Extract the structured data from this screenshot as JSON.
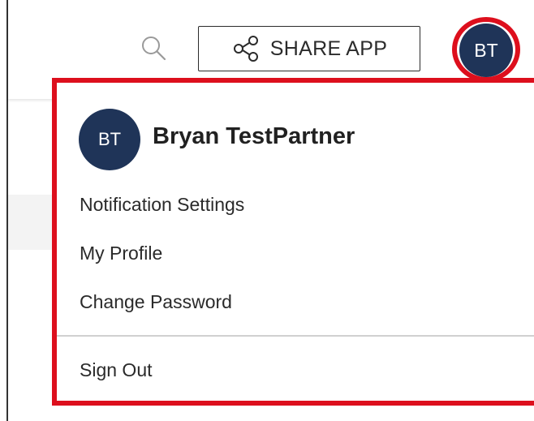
{
  "header": {
    "search_icon": "search-icon",
    "share_button": {
      "icon": "share-icon",
      "label": "SHARE APP"
    },
    "avatar_initials": "BT"
  },
  "user_menu": {
    "avatar_initials": "BT",
    "user_name": "Bryan TestPartner",
    "items": [
      {
        "label": "Notification Settings"
      },
      {
        "label": "My Profile"
      },
      {
        "label": "Change Password"
      }
    ],
    "sign_out_label": "Sign Out"
  },
  "colors": {
    "highlight_red": "#dd0f1d",
    "avatar_navy": "#1f3458"
  }
}
